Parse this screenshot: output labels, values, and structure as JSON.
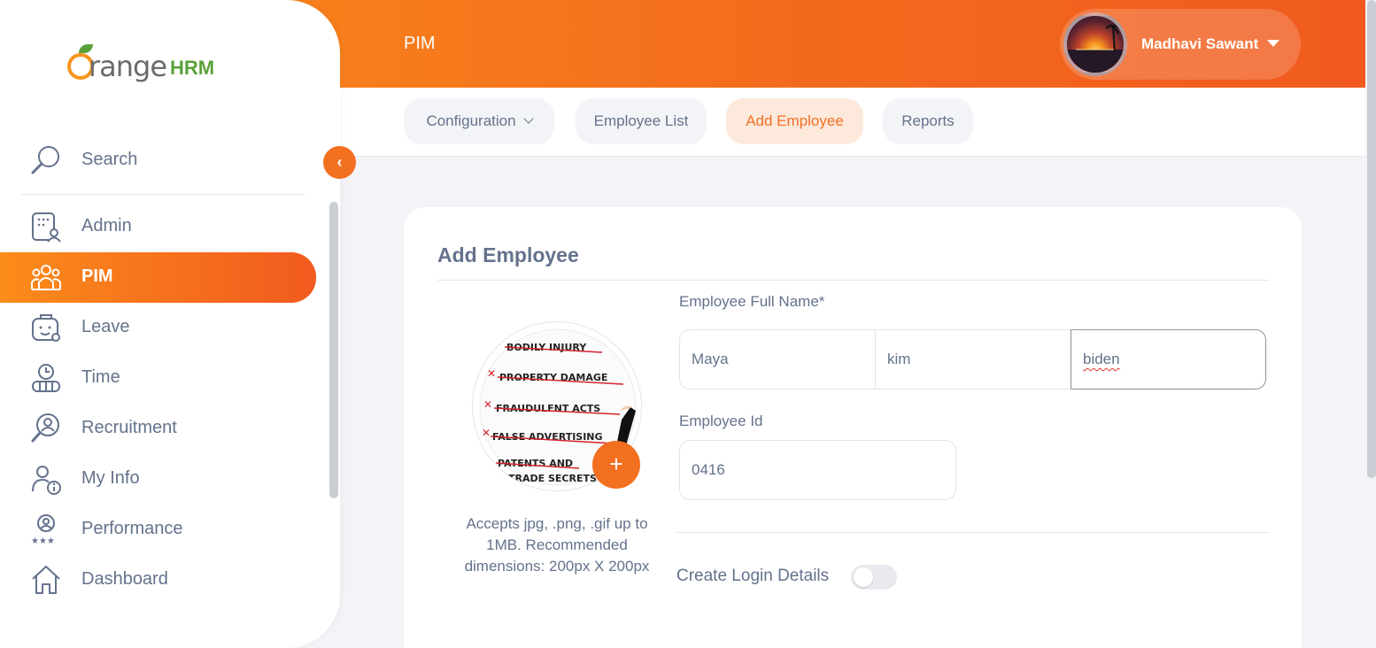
{
  "header": {
    "module_title": "PIM",
    "user_name": "Madhavi Sawant"
  },
  "logo": {
    "brand_word": "range",
    "brand_suffix": "HRM"
  },
  "subnav": {
    "tabs": [
      {
        "label": "Configuration",
        "has_dropdown": true
      },
      {
        "label": "Employee List"
      },
      {
        "label": "Add Employee",
        "active": true
      },
      {
        "label": "Reports"
      }
    ]
  },
  "sidebar": {
    "search_label": "Search",
    "items": [
      {
        "label": "Admin",
        "icon": "admin-icon"
      },
      {
        "label": "PIM",
        "icon": "pim-icon",
        "active": true
      },
      {
        "label": "Leave",
        "icon": "leave-icon"
      },
      {
        "label": "Time",
        "icon": "time-icon"
      },
      {
        "label": "Recruitment",
        "icon": "recruitment-icon"
      },
      {
        "label": "My Info",
        "icon": "my-info-icon"
      },
      {
        "label": "Performance",
        "icon": "performance-icon"
      },
      {
        "label": "Dashboard",
        "icon": "dashboard-icon"
      }
    ]
  },
  "form": {
    "title": "Add Employee",
    "full_name_label": "Employee Full Name*",
    "first_name": "Maya",
    "middle_name": "kim",
    "last_name": "biden",
    "employee_id_label": "Employee Id",
    "employee_id": "0416",
    "photo_hint": "Accepts jpg, .png, .gif up to 1MB. Recommended dimensions: 200px X 200px",
    "photo_text_lines": [
      "BODILY INJURY",
      "PROPERTY DAMAGE",
      "FRAUDULENT ACTS",
      "FALSE ADVERTISING",
      "PATENTS AND",
      "TRADE SECRETS"
    ],
    "create_login_label": "Create Login Details",
    "create_login_enabled": false
  },
  "colors": {
    "accent": "#f37021",
    "text_muted": "#64728c",
    "leaf_green": "#5aa13a"
  }
}
